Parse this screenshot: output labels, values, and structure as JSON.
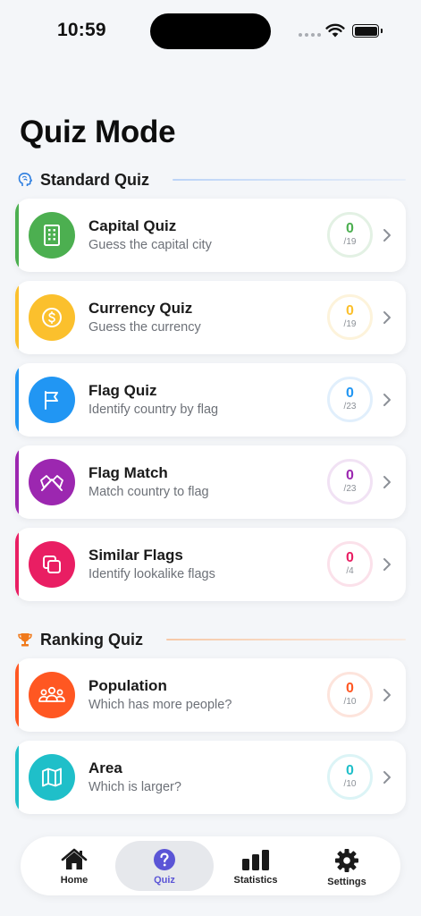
{
  "status": {
    "time": "10:59"
  },
  "page": {
    "title": "Quiz Mode"
  },
  "sections": {
    "standard": {
      "label": "Standard Quiz",
      "icon": "brain-icon"
    },
    "ranking": {
      "label": "Ranking Quiz",
      "icon": "trophy-icon"
    }
  },
  "standard_quizzes": [
    {
      "title": "Capital Quiz",
      "subtitle": "Guess the capital city",
      "score": "0",
      "total": "/19",
      "color": "#4caf50",
      "icon": "building-icon"
    },
    {
      "title": "Currency Quiz",
      "subtitle": "Guess the currency",
      "score": "0",
      "total": "/19",
      "color": "#fbc02d",
      "icon": "coin-icon"
    },
    {
      "title": "Flag Quiz",
      "subtitle": "Identify country by flag",
      "score": "0",
      "total": "/23",
      "color": "#2196f3",
      "icon": "flag-icon"
    },
    {
      "title": "Flag Match",
      "subtitle": "Match country to flag",
      "score": "0",
      "total": "/23",
      "color": "#9c27b0",
      "icon": "crossed-flags-icon"
    },
    {
      "title": "Similar Flags",
      "subtitle": "Identify lookalike flags",
      "score": "0",
      "total": "/4",
      "color": "#e91e63",
      "icon": "copy-icon"
    }
  ],
  "ranking_quizzes": [
    {
      "title": "Population",
      "subtitle": "Which has more people?",
      "score": "0",
      "total": "/10",
      "color": "#ff5722",
      "icon": "people-icon"
    },
    {
      "title": "Area",
      "subtitle": "Which is larger?",
      "score": "0",
      "total": "/10",
      "color": "#1fbfc9",
      "icon": "map-icon"
    }
  ],
  "tabs": [
    {
      "label": "Home",
      "icon": "house-icon"
    },
    {
      "label": "Quiz",
      "icon": "question-icon",
      "active": true
    },
    {
      "label": "Statistics",
      "icon": "bar-chart-icon"
    },
    {
      "label": "Settings",
      "icon": "gear-icon"
    }
  ],
  "colors": {
    "accent": "#5b55d6",
    "background": "#f4f6f9"
  }
}
